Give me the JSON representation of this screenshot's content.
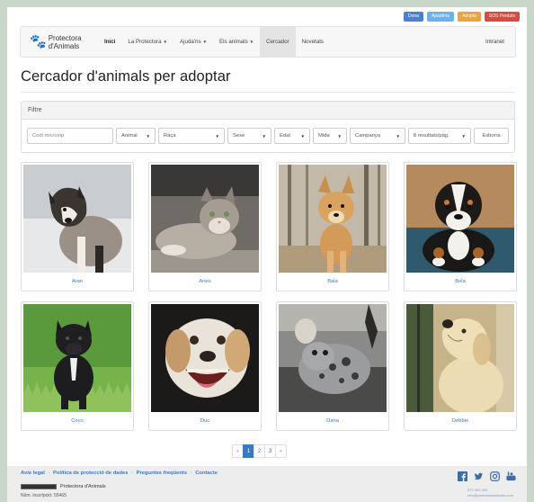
{
  "top_buttons": [
    {
      "label": "Dona",
      "color": "#4a7fd1"
    },
    {
      "label": "Apadrina",
      "color": "#6bb2e8"
    },
    {
      "label": "Adopta",
      "color": "#e9a33f"
    },
    {
      "label": "SOS Perduts",
      "color": "#d64b42"
    }
  ],
  "logo": {
    "line1": "Protectora",
    "line2": "d'Animals"
  },
  "nav": {
    "items": [
      {
        "label": "Inici"
      },
      {
        "label": "La Protectora"
      },
      {
        "label": "Ajuda'ns"
      },
      {
        "label": "Els animals"
      },
      {
        "label": "Cercador"
      },
      {
        "label": "Novetats"
      }
    ],
    "intranet": "Intranet"
  },
  "page_title": "Cercador d'animals per adoptar",
  "filter": {
    "title": "Filtre",
    "microchip_placeholder": "Codi microxip",
    "animal": "Animal",
    "breed": "Raça",
    "sex": "Sexe",
    "age": "Edat",
    "size": "Mida",
    "campaign": "Campanya",
    "per_page": "8 resultats/pàg.",
    "clear": "Esborra"
  },
  "animals": [
    {
      "name": "Aran"
    },
    {
      "name": "Aries"
    },
    {
      "name": "Bala"
    },
    {
      "name": "Bola"
    },
    {
      "name": "Coco"
    },
    {
      "name": "Duc"
    },
    {
      "name": "Dana"
    },
    {
      "name": "Debbie"
    }
  ],
  "pagination": {
    "prev": "«",
    "pages": [
      "1",
      "2",
      "3"
    ],
    "next": "»",
    "current": "1"
  },
  "footer": {
    "links": [
      "Avís legal",
      "Política de protecció de dades",
      "Preguntes freqüents",
      "Contacte"
    ],
    "separator": "·",
    "license": "Protectora d'Animals",
    "registration": "Núm. inscripció: 55465",
    "phone": "972 000 000",
    "email": "info@protectoraanimals.com"
  }
}
